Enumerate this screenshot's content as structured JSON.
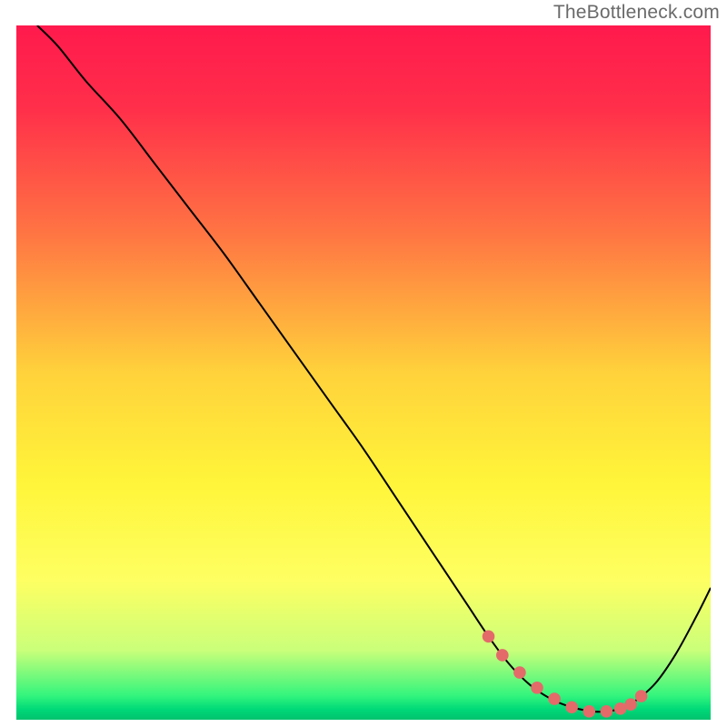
{
  "watermark": "TheBottleneck.com",
  "chart_data": {
    "type": "line",
    "title": "",
    "xlabel": "",
    "ylabel": "",
    "xlim": [
      0,
      100
    ],
    "ylim": [
      0,
      100
    ],
    "background_gradient": {
      "stops": [
        {
          "offset": 0,
          "color": "#ff1a4d"
        },
        {
          "offset": 0.12,
          "color": "#ff2f4a"
        },
        {
          "offset": 0.3,
          "color": "#ff7543"
        },
        {
          "offset": 0.5,
          "color": "#ffd23b"
        },
        {
          "offset": 0.66,
          "color": "#fff53a"
        },
        {
          "offset": 0.8,
          "color": "#feff62"
        },
        {
          "offset": 0.9,
          "color": "#caff7a"
        },
        {
          "offset": 0.965,
          "color": "#34f57d"
        },
        {
          "offset": 0.985,
          "color": "#00d978"
        },
        {
          "offset": 1.0,
          "color": "#00c26e"
        }
      ]
    },
    "series": [
      {
        "name": "bottleneck-curve",
        "color": "#000000",
        "width": 2,
        "x": [
          3,
          6,
          10,
          15,
          20,
          25,
          30,
          35,
          40,
          45,
          50,
          55,
          60,
          62,
          65,
          68,
          71,
          74,
          77,
          80,
          83,
          85,
          87,
          89,
          92,
          95,
          98,
          100
        ],
        "y": [
          100,
          97,
          92,
          86.5,
          80,
          73.5,
          67,
          60,
          53,
          46,
          39,
          31.5,
          24,
          21,
          16.5,
          12,
          8,
          5,
          3,
          1.8,
          1.2,
          1.2,
          1.6,
          2.6,
          5.2,
          9.5,
          15,
          19
        ]
      }
    ],
    "markers": {
      "name": "highlight-dots",
      "color": "#e46a6a",
      "radius": 6.8,
      "x": [
        68,
        70,
        72.5,
        75,
        77.5,
        80,
        82.5,
        85,
        87,
        88.5,
        90
      ],
      "y": [
        12,
        9.3,
        6.8,
        4.6,
        3.0,
        1.8,
        1.2,
        1.2,
        1.6,
        2.2,
        3.4
      ]
    }
  }
}
